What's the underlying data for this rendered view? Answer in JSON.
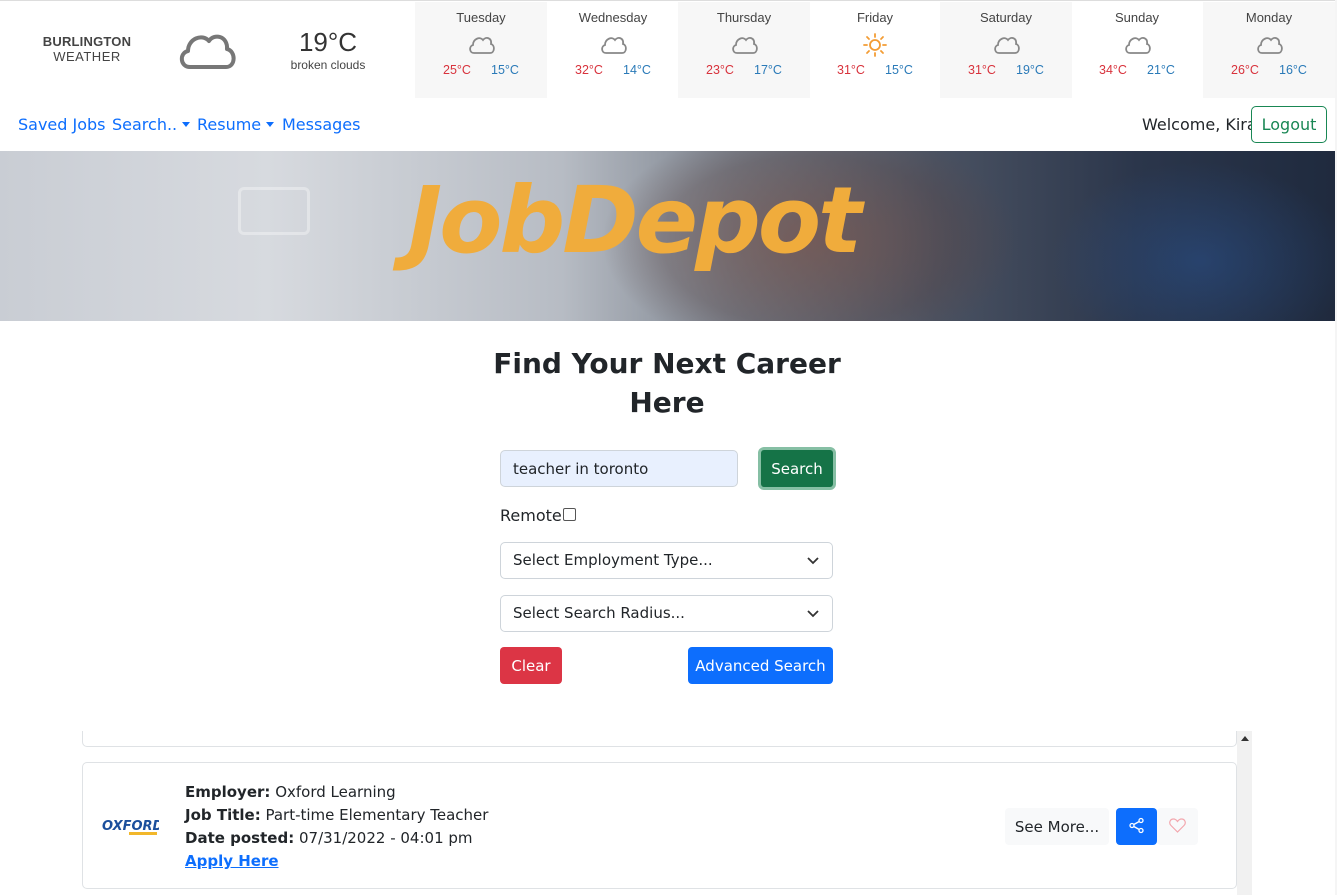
{
  "weather": {
    "city": "BURLINGTON",
    "label": "WEATHER",
    "current_temp": "19°C",
    "current_desc": "broken clouds",
    "current_icon": "cloud-icon",
    "days": [
      {
        "name": "Tuesday",
        "hi": "25°C",
        "lo": "15°C",
        "icon": "cloud-icon"
      },
      {
        "name": "Wednesday",
        "hi": "32°C",
        "lo": "14°C",
        "icon": "cloud-icon"
      },
      {
        "name": "Thursday",
        "hi": "23°C",
        "lo": "17°C",
        "icon": "cloud-icon"
      },
      {
        "name": "Friday",
        "hi": "31°C",
        "lo": "15°C",
        "icon": "sun-icon"
      },
      {
        "name": "Saturday",
        "hi": "31°C",
        "lo": "19°C",
        "icon": "cloud-icon"
      },
      {
        "name": "Sunday",
        "hi": "34°C",
        "lo": "21°C",
        "icon": "cloud-icon"
      },
      {
        "name": "Monday",
        "hi": "26°C",
        "lo": "16°C",
        "icon": "cloud-icon"
      }
    ],
    "colors": {
      "hi": "#d8323c",
      "lo": "#2a7ab8",
      "sun": "#f39c34"
    }
  },
  "nav": {
    "saved_jobs": "Saved Jobs",
    "search": "Search..",
    "resume": "Resume",
    "messages": "Messages",
    "welcome": "Welcome, Kira",
    "logout": "Logout"
  },
  "hero": {
    "logo": "JobDepot",
    "logo_color": "#f0ac3c"
  },
  "search": {
    "title": "Find Your Next Career Here",
    "query": "teacher in toronto",
    "search_button": "Search",
    "remote_label": "Remote",
    "remote_checked": false,
    "employment_type": "Select Employment Type...",
    "search_radius": "Select Search Radius...",
    "clear_button": "Clear",
    "advanced_button": "Advanced Search"
  },
  "results": [
    {
      "employer_label": "Employer:",
      "employer": "Oxford Learning",
      "title_label": "Job Title:",
      "title": "Part-time Elementary Teacher",
      "date_label": "Date posted:",
      "date": "07/31/2022 - 04:01 pm",
      "apply": "Apply Here",
      "logo_text": "OXFORD",
      "see_more": "See More...",
      "share_icon": "share-icon",
      "favorite_icon": "heart-icon"
    }
  ],
  "accent_colors": {
    "primary": "#0d6efd",
    "success": "#198754",
    "danger": "#dc3545"
  }
}
